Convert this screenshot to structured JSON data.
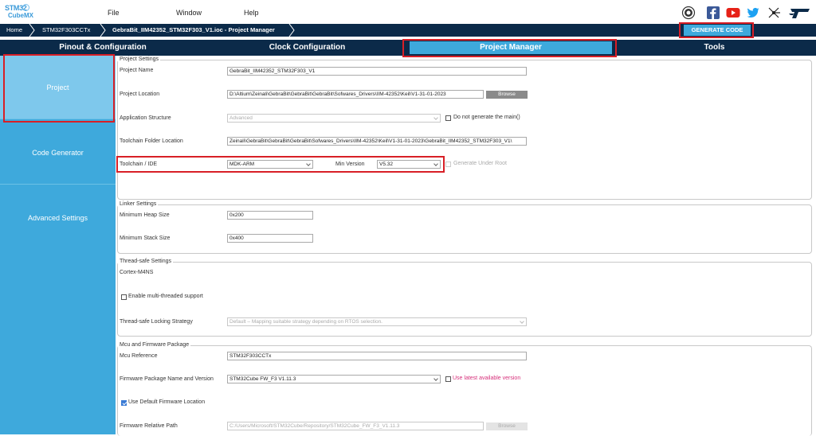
{
  "app": {
    "logo_line1": "STM32",
    "logo_line2": "CubeMX",
    "logo_badge": ""
  },
  "menu": [
    "File",
    "Window",
    "Help"
  ],
  "social_icons": [
    "anniversary-icon",
    "facebook-icon",
    "youtube-icon",
    "twitter-icon",
    "network-icon",
    "st-logo-icon"
  ],
  "breadcrumb": [
    "Home",
    "STM32F303CCTx",
    "GebraBit_IIM42352_STM32F303_V1.ioc - Project Manager"
  ],
  "generate_button": "GENERATE CODE",
  "tabs": [
    "Pinout & Configuration",
    "Clock Configuration",
    "Project Manager",
    "Tools"
  ],
  "sidebar": [
    "Project",
    "Code Generator",
    "Advanced Settings"
  ],
  "project_settings": {
    "title": "Project Settings",
    "project_name_label": "Project Name",
    "project_name_value": "GebraBit_IIM42352_STM32F303_V1",
    "project_location_label": "Project Location",
    "project_location_value": "D:\\Altium\\Zeinali\\GebraBit\\GebraBit\\GebraBit\\Sofwares_Drivers\\IIM-42352\\Keil\\V1-31-01-2023",
    "browse_label": "Browse",
    "app_structure_label": "Application Structure",
    "app_structure_value": "Advanced",
    "no_main_label": "Do not generate the main()",
    "toolchain_folder_label": "Toolchain Folder Location",
    "toolchain_folder_value": "Zeinali\\GebraBit\\GebraBit\\GebraBit\\Sofwares_Drivers\\IIM-42352\\Keil\\V1-31-01-2023\\GebraBit_IIM42352_STM32F303_V1\\",
    "toolchain_label": "Toolchain / IDE",
    "toolchain_value": "MDK-ARM",
    "min_version_label": "Min Version",
    "min_version_value": "V5.32",
    "under_root_label": "Generate Under Root"
  },
  "linker_settings": {
    "title": "Linker Settings",
    "heap_label": "Minimum Heap Size",
    "heap_value": "0x200",
    "stack_label": "Minimum Stack Size",
    "stack_value": "0x400"
  },
  "thread_settings": {
    "title": "Thread-safe Settings",
    "core": "Cortex-M4NS",
    "multi_thread_label": "Enable multi-threaded support",
    "locking_label": "Thread-safe Locking Strategy",
    "locking_value": "Default – Mapping suitable strategy depending on RTOS selection."
  },
  "mcu_firmware": {
    "title": "Mcu and Firmware Package",
    "mcu_ref_label": "Mcu Reference",
    "mcu_ref_value": "STM32F303CCTx",
    "fw_name_label": "Firmware Package Name and Version",
    "fw_name_value": "STM32Cube FW_F3 V1.11.3",
    "use_latest_label": "Use latest available version",
    "use_default_label": "Use Default Firmware Location",
    "fw_path_label": "Firmware Relative Path",
    "fw_path_value": "C:/Users/Microsoft/STM32Cube/Repository/STM32Cube_FW_F3_V1.11.3",
    "browse_label": "Browse"
  },
  "colors": {
    "navy": "#0b2a49",
    "accent": "#3ea9dc",
    "highlight": "#d81f26"
  }
}
